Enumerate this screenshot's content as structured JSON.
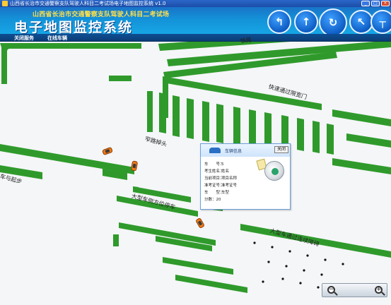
{
  "window": {
    "title": "山西省长治市交通警察支队驾驶人科目二考试场电子地图监控系统 v1.0",
    "min_label": "_",
    "max_label": "□",
    "close_label": "×"
  },
  "banner": {
    "subtitle": "山西省长治市交通警察支队驾驶人科目二考试场",
    "title": "电子地图监控系统"
  },
  "tabs": [
    {
      "label": "关闭服务"
    },
    {
      "label": "在线车辆"
    }
  ],
  "map": {
    "labels": [
      {
        "text": "铁路"
      },
      {
        "text": "快速通过限宽门"
      },
      {
        "text": "窄路掉头"
      },
      {
        "text": "车与起步"
      },
      {
        "text": "大型车侧方位停车"
      },
      {
        "text": "大型车通过连续障碍"
      }
    ]
  },
  "popup": {
    "title": "车辆信息",
    "close_label": "关闭",
    "rows": [
      {
        "key": "车　　号：",
        "value": "5"
      },
      {
        "key": "考生姓名：",
        "value": "姓名"
      },
      {
        "key": "当前项目：",
        "value": "项目名称"
      },
      {
        "key": "准考证号：",
        "value": "准考证号"
      },
      {
        "key": "车　　型：",
        "value": "车型"
      },
      {
        "key": "分数：",
        "value": "20"
      }
    ]
  },
  "zoom": {
    "out_symbol": "−",
    "in_symbol": "+"
  },
  "colors": {
    "green": "#2f9a2b",
    "map_bg": "#f4f6f8",
    "car": "#f07a18",
    "header_blue": "#1492d8"
  }
}
